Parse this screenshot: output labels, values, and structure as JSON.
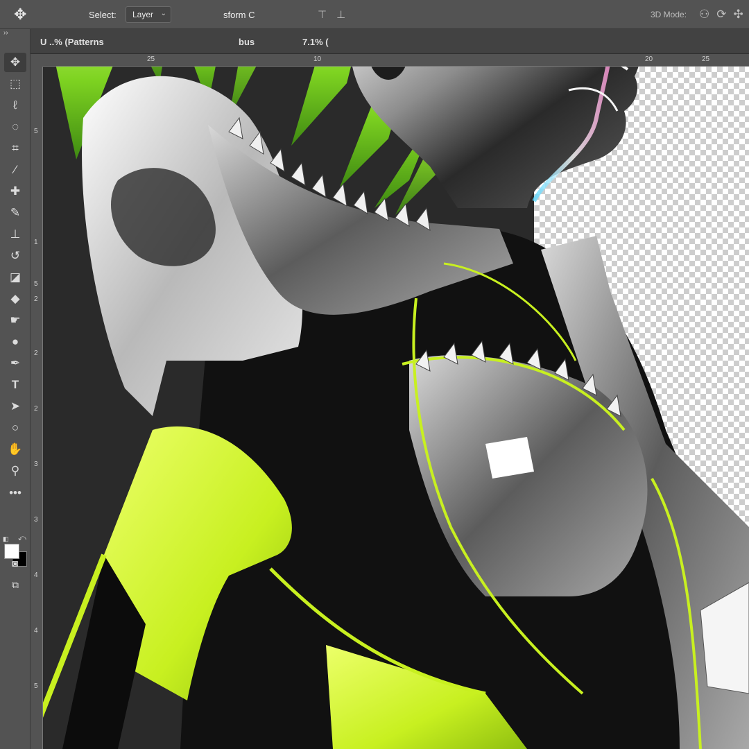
{
  "options_bar": {
    "move_icon": "move-arrows-icon",
    "auto_select_label": "Select:",
    "auto_select_value": "Layer",
    "transform_label": "sform C",
    "mode_3d_label": "3D Mode:"
  },
  "tabs": [
    {
      "label": "U  ..% (Patterns",
      "active": false
    },
    {
      "label": "bus",
      "zoom": "7.1% (",
      "active": true
    }
  ],
  "rulers": {
    "top": [
      "25",
      "10",
      "20",
      "25"
    ],
    "left": [
      "5",
      "1",
      "5",
      "2",
      "2",
      "2",
      "3",
      "3",
      "4",
      "4",
      "5"
    ]
  },
  "tools": [
    "move-tool-icon",
    "marquee-tool-icon",
    "lasso-tool-icon",
    "quick-select-tool-icon",
    "crop-tool-icon",
    "eyedropper-tool-icon",
    "healing-brush-tool-icon",
    "brush-tool-icon",
    "clone-stamp-tool-icon",
    "history-brush-tool-icon",
    "eraser-tool-icon",
    "paint-bucket-tool-icon",
    "smudge-tool-icon",
    "dodge-tool-icon",
    "pen-tool-icon",
    "type-tool-icon",
    "path-select-tool-icon",
    "ellipse-tool-icon",
    "hand-tool-icon",
    "zoom-tool-icon",
    "more-tools-icon"
  ],
  "colors": {
    "ui_panel": "#535353",
    "accent_green": "#c8f020",
    "foreground_swatch": "#ffffff",
    "background_swatch": "#000000"
  }
}
